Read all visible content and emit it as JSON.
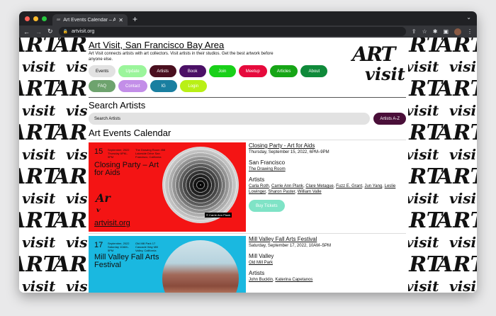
{
  "browser": {
    "tab_title": "Art Events Calendar – Art Visit",
    "tab_favicon": "av",
    "url": "artvisit.org",
    "traffic_colors": [
      "#ff5f57",
      "#febc2e",
      "#28c840"
    ]
  },
  "site": {
    "title": "Art Visit, San Francisco Bay Area",
    "tagline": "Art Visit connects artists with art collectors. Visit artists in their studios. Get the best artwork before anyone else.",
    "logo_line1": "ART",
    "logo_line2": "visit",
    "pattern_word1": "ART",
    "pattern_word2": "visit"
  },
  "nav": [
    {
      "label": "Events",
      "bg": "#e2e2e2",
      "fg": "#111111"
    },
    {
      "label": "Update",
      "bg": "#9bf59b",
      "fg": "#ffffff"
    },
    {
      "label": "Artists",
      "bg": "#4a0f1f",
      "fg": "#ffffff"
    },
    {
      "label": "Book",
      "bg": "#4b1066",
      "fg": "#ffffff"
    },
    {
      "label": "Join",
      "bg": "#19d019",
      "fg": "#ffffff"
    },
    {
      "label": "Meetup",
      "bg": "#e60a3c",
      "fg": "#ffffff"
    },
    {
      "label": "Articles",
      "bg": "#16a516",
      "fg": "#ffffff"
    },
    {
      "label": "About",
      "bg": "#0f8a3a",
      "fg": "#ffffff"
    },
    {
      "label": "FAQ",
      "bg": "#6ea36e",
      "fg": "#ffffff"
    },
    {
      "label": "Contact",
      "bg": "#c38ee8",
      "fg": "#ffffff"
    },
    {
      "label": "IG",
      "bg": "#1a7fa0",
      "fg": "#ffffff"
    },
    {
      "label": "Login",
      "bg": "#b9f016",
      "fg": "#ffffff"
    }
  ],
  "search": {
    "heading": "Search Artists",
    "placeholder": "Search Artists",
    "az_label": "Artists A-Z"
  },
  "calendar_heading": "Art Events Calendar",
  "events": [
    {
      "poster_bg": "#f41414",
      "day": "15",
      "date_small": "September, 2022 Thursday 6PM–9PM",
      "venue_small": "The Drawing Room 458 Lakeside Drive San Francisco, California",
      "poster_title": "Closing Party – Art for Aids",
      "poster_brand": "artvisit.org",
      "photo_caption": "© Carrie Ann Plank",
      "title": "Closing Party - Art for Aids",
      "datetime": "Thursday, September 15, 2022, 6PM–9PM",
      "city": "San Francisco",
      "venue": "The Drawing Room",
      "artists_heading": "Artists",
      "artists": [
        "Carla Roth",
        "Carrie Ann Plank",
        "Clare Metague",
        "Fuzz E. Grant",
        "Jun Yang",
        "Leslie Lowinger",
        "Sharon Paster",
        "William Valle"
      ],
      "ticket_label": "Buy Tickets"
    },
    {
      "poster_bg": "#1ab8e0",
      "day": "17",
      "date_small": "September, 2022 Saturday 10AM–5PM",
      "venue_small": "Old Mill Park 17 Cascade Way Mill Valley, California",
      "poster_title": "Mill Valley Fall Arts Festival",
      "title": "Mill Valley Fall Arts Festival",
      "datetime": "Saturday, September 17, 2022, 10AM–5PM",
      "city": "Mill Valley",
      "venue": "Old Mill Park",
      "artists_heading": "Artists",
      "artists": [
        "John Bucklin",
        "Katerina Capetanos"
      ]
    }
  ]
}
